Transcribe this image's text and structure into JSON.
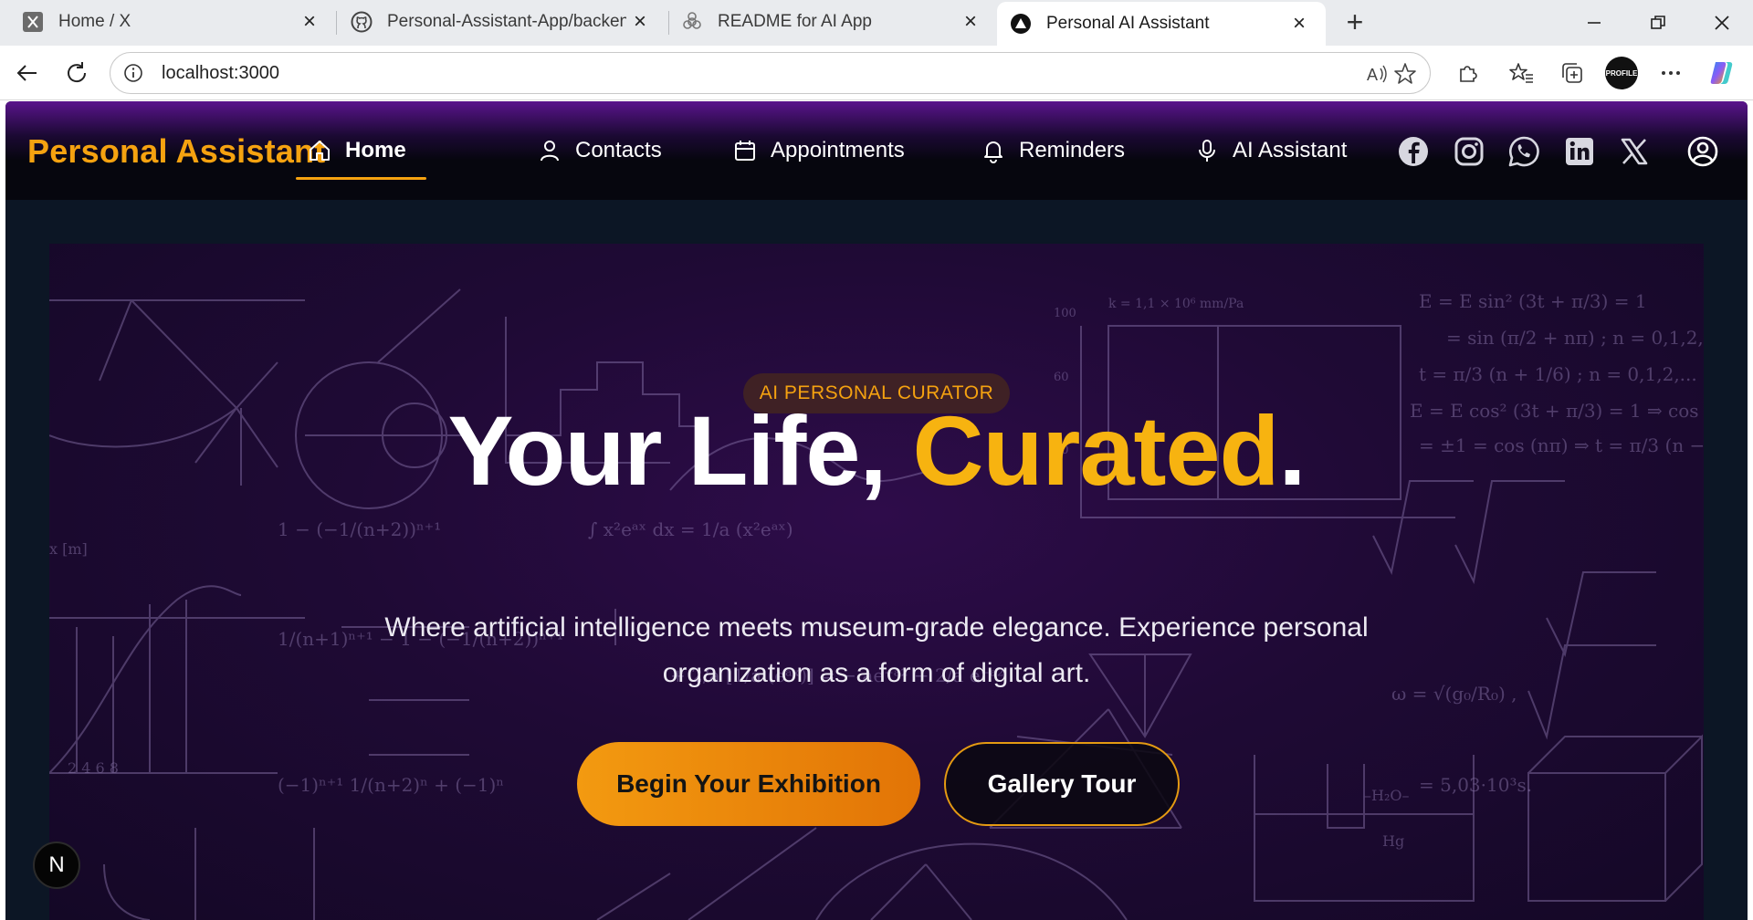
{
  "browser": {
    "tabs": [
      {
        "title": "Home / X",
        "icon": "x-logo-icon"
      },
      {
        "title": "Personal-Assistant-App/backend/",
        "icon": "github-icon"
      },
      {
        "title": "README for AI App",
        "icon": "openai-icon"
      },
      {
        "title": "Personal AI Assistant",
        "icon": "app-logo-icon",
        "active": true
      }
    ],
    "url": "localhost:3000",
    "profile_label": "PROFILE"
  },
  "app": {
    "brand": "Personal Assistant",
    "brand_color": "#f5a210",
    "nav": [
      {
        "label": "Home",
        "icon": "home-icon",
        "active": true
      },
      {
        "label": "Contacts",
        "icon": "user-icon"
      },
      {
        "label": "Appointments",
        "icon": "calendar-icon"
      },
      {
        "label": "Reminders",
        "icon": "bell-icon"
      },
      {
        "label": "AI Assistant",
        "icon": "microphone-icon"
      }
    ],
    "social": [
      "facebook-icon",
      "instagram-icon",
      "whatsapp-icon",
      "linkedin-icon",
      "x-icon",
      "account-icon"
    ]
  },
  "hero": {
    "badge": "AI PERSONAL CURATOR",
    "headline_part1": "Your Life, ",
    "headline_accent": "Curated",
    "headline_end": ".",
    "subtitle": "Where artificial intelligence meets museum-grade elegance. Experience personal organization as a form of digital art.",
    "primary_cta": "Begin Your Exhibition",
    "secondary_cta": "Gallery Tour"
  },
  "dev_badge": "N"
}
